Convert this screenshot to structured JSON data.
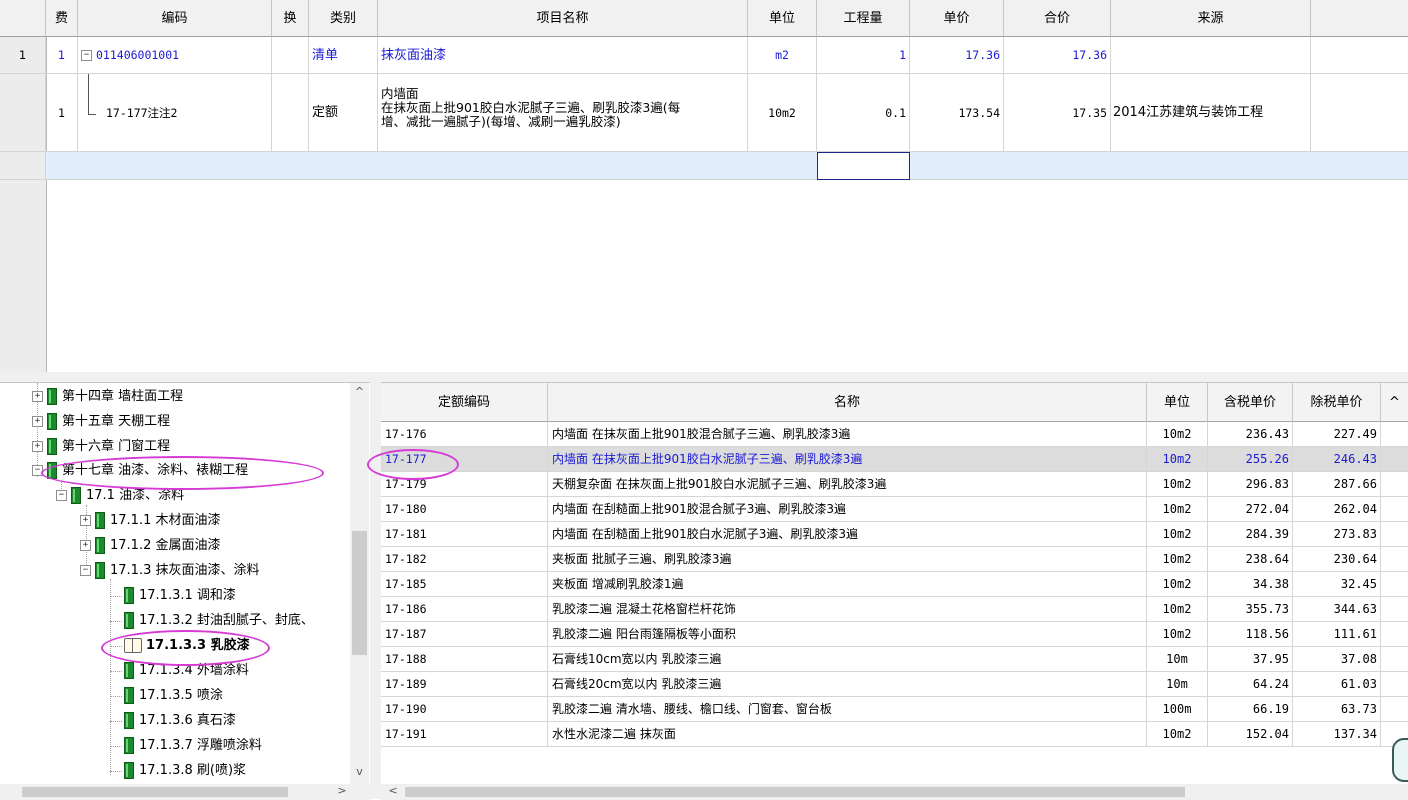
{
  "top_grid": {
    "columns": [
      "费",
      "编码",
      "换",
      "类别",
      "项目名称",
      "单位",
      "工程量",
      "单价",
      "合价",
      "来源"
    ],
    "rows": [
      {
        "row_no": "1",
        "fee": "1",
        "expand": "−",
        "code": "011406001001",
        "type": "清单",
        "name": "抹灰面油漆",
        "unit": "m2",
        "qty": "1",
        "price": "17.36",
        "total": "17.36",
        "source": ""
      },
      {
        "row_no": "",
        "fee": "1",
        "code": "17-177注注2",
        "type": "定额",
        "name_line1": "内墙面",
        "name_line2": "在抹灰面上批901胶白水泥腻子三遍、刷乳胶漆3遍(每",
        "name_line3": "增、减批一遍腻子)(每增、减刷一遍乳胶漆)",
        "unit": "10m2",
        "qty": "0.1",
        "price": "173.54",
        "total": "17.35",
        "source": "2014江苏建筑与装饰工程"
      }
    ]
  },
  "tree": {
    "items": [
      {
        "label": "第十四章 墙柱面工程",
        "expand": "+"
      },
      {
        "label": "第十五章 天棚工程",
        "expand": "+"
      },
      {
        "label": "第十六章 门窗工程",
        "expand": "+"
      },
      {
        "label": "第十七章 油漆、涂料、裱糊工程",
        "expand": "−"
      },
      {
        "label": "17.1  油漆、涂料",
        "expand": "−"
      },
      {
        "label": "17.1.1  木材面油漆",
        "expand": "+"
      },
      {
        "label": "17.1.2  金属面油漆",
        "expand": "+"
      },
      {
        "label": "17.1.3  抹灰面油漆、涂料",
        "expand": "−"
      },
      {
        "label": "17.1.3.1  调和漆"
      },
      {
        "label": "17.1.3.2  封油刮腻子、封底、"
      },
      {
        "label": "17.1.3.3  乳胶漆"
      },
      {
        "label": "17.1.3.4  外墙涂料"
      },
      {
        "label": "17.1.3.5  喷涂"
      },
      {
        "label": "17.1.3.6  真石漆"
      },
      {
        "label": "17.1.3.7  浮雕喷涂料"
      },
      {
        "label": "17.1.3.8  刷(喷)浆"
      }
    ],
    "scroll_up": "^",
    "scroll_down": "v",
    "scroll_right": ">"
  },
  "quota_list": {
    "columns": [
      "定额编码",
      "名称",
      "单位",
      "含税单价",
      "除税单价",
      "^"
    ],
    "rows": [
      {
        "code": "17-176",
        "name": "内墙面 在抹灰面上批901胶混合腻子三遍、刷乳胶漆3遍",
        "unit": "10m2",
        "tax_price": "236.43",
        "net_price": "227.49"
      },
      {
        "code": "17-177",
        "name": "内墙面 在抹灰面上批901胶白水泥腻子三遍、刷乳胶漆3遍",
        "unit": "10m2",
        "tax_price": "255.26",
        "net_price": "246.43"
      },
      {
        "code": "17-179",
        "name": "天棚复杂面 在抹灰面上批901胶白水泥腻子三遍、刷乳胶漆3遍",
        "unit": "10m2",
        "tax_price": "296.83",
        "net_price": "287.66"
      },
      {
        "code": "17-180",
        "name": "内墙面 在刮糙面上批901胶混合腻子3遍、刷乳胶漆3遍",
        "unit": "10m2",
        "tax_price": "272.04",
        "net_price": "262.04"
      },
      {
        "code": "17-181",
        "name": "内墙面 在刮糙面上批901胶白水泥腻子3遍、刷乳胶漆3遍",
        "unit": "10m2",
        "tax_price": "284.39",
        "net_price": "273.83"
      },
      {
        "code": "17-182",
        "name": "夹板面 批腻子三遍、刷乳胶漆3遍",
        "unit": "10m2",
        "tax_price": "238.64",
        "net_price": "230.64"
      },
      {
        "code": "17-185",
        "name": "夹板面 增减刷乳胶漆1遍",
        "unit": "10m2",
        "tax_price": "34.38",
        "net_price": "32.45"
      },
      {
        "code": "17-186",
        "name": "乳胶漆二遍 混凝土花格窗栏杆花饰",
        "unit": "10m2",
        "tax_price": "355.73",
        "net_price": "344.63"
      },
      {
        "code": "17-187",
        "name": "乳胶漆二遍 阳台雨篷隔板等小面积",
        "unit": "10m2",
        "tax_price": "118.56",
        "net_price": "111.61"
      },
      {
        "code": "17-188",
        "name": "石膏线10cm宽以内 乳胶漆三遍",
        "unit": "10m",
        "tax_price": "37.95",
        "net_price": "37.08"
      },
      {
        "code": "17-189",
        "name": "石膏线20cm宽以内 乳胶漆三遍",
        "unit": "10m",
        "tax_price": "64.24",
        "net_price": "61.03"
      },
      {
        "code": "17-190",
        "name": "乳胶漆二遍 清水墙、腰线、檐口线、门窗套、窗台板",
        "unit": "100m",
        "tax_price": "66.19",
        "net_price": "63.73"
      },
      {
        "code": "17-191",
        "name": "水性水泥漆二遍 抹灰面",
        "unit": "10m2",
        "tax_price": "152.04",
        "net_price": "137.34"
      }
    ],
    "scroll_left": "<"
  },
  "colors": {
    "accent_text": "#1a1ad6",
    "annotation": "#d63bd6",
    "selected_row": "#dcdcdc",
    "editing_row": "#e2eefa"
  }
}
